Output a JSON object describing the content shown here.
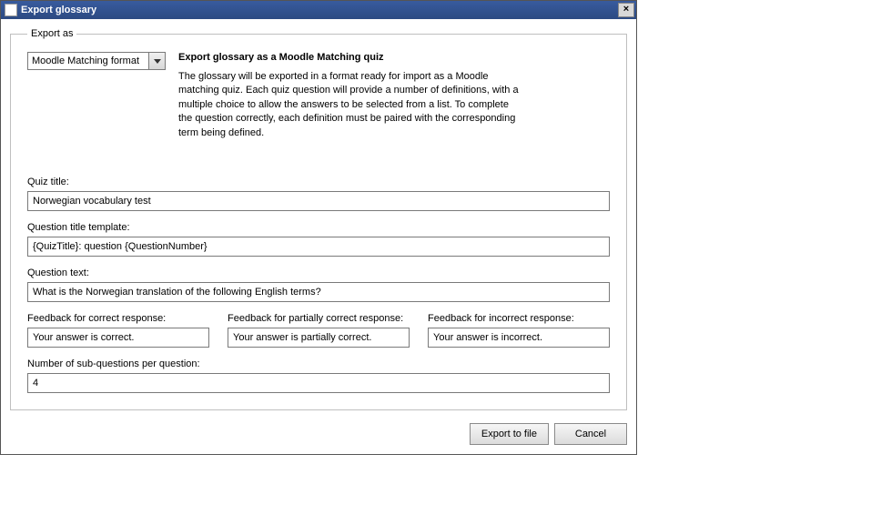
{
  "window": {
    "title": "Export glossary",
    "close_label": "×"
  },
  "group": {
    "legend": "Export as"
  },
  "format": {
    "selected": "Moodle Matching format"
  },
  "description": {
    "heading": "Export glossary as a Moodle Matching quiz",
    "body": "The glossary will be exported in a format ready for import as a Moodle matching quiz. Each quiz question will provide a number of definitions, with a multiple choice to allow the answers to be selected from a list. To complete the question correctly, each definition must be paired with the corresponding term being defined."
  },
  "fields": {
    "quiz_title": {
      "label": "Quiz title:",
      "value": "Norwegian vocabulary test"
    },
    "question_title_template": {
      "label": "Question title template:",
      "value": "{QuizTitle}: question {QuestionNumber}"
    },
    "question_text": {
      "label": "Question text:",
      "value": "What is the Norwegian translation of the following English terms?"
    },
    "feedback_correct": {
      "label": "Feedback for correct response:",
      "value": "Your answer is correct."
    },
    "feedback_partial": {
      "label": "Feedback for partially correct response:",
      "value": "Your answer is partially correct."
    },
    "feedback_incorrect": {
      "label": "Feedback for incorrect response:",
      "value": "Your answer is incorrect."
    },
    "num_subquestions": {
      "label": "Number of sub-questions per question:",
      "value": "4"
    }
  },
  "buttons": {
    "export": "Export to file",
    "cancel": "Cancel"
  }
}
